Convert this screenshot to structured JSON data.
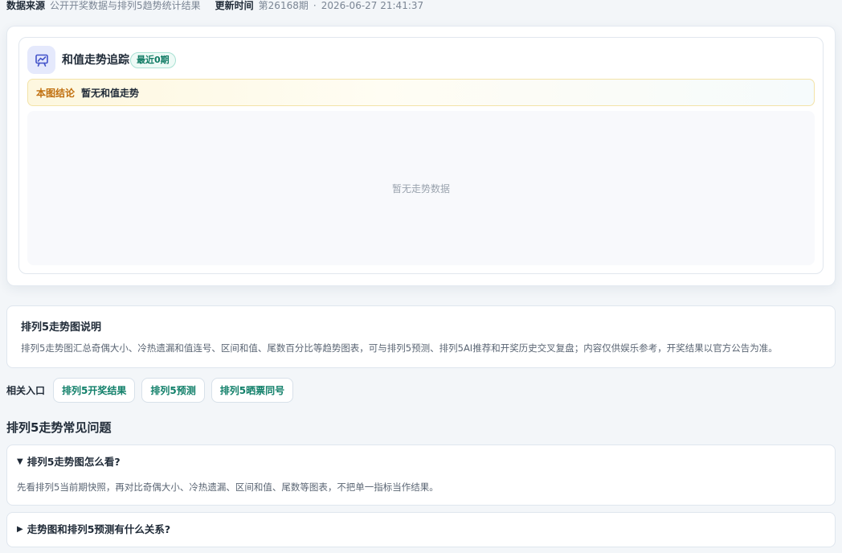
{
  "meta": {
    "source_label": "数据来源",
    "source_value": "公开开奖数据与排列5趋势统计结果",
    "update_label": "更新时间",
    "issue": "第26168期",
    "dot": "·",
    "timestamp": "2026-06-27 21:41:37"
  },
  "chart_card": {
    "icon": "trend-chart-icon",
    "title": "和值走势追踪",
    "badge": "最近0期",
    "conclusion_label": "本图结论",
    "conclusion_text": "暂无和值走势",
    "empty_text": "暂无走势数据"
  },
  "explain": {
    "title": "排列5走势图说明",
    "body": "排列5走势图汇总奇偶大小、冷热遗漏和值连号、区间和值、尾数百分比等趋势图表，可与排列5预测、排列5AI推荐和开奖历史交叉复盘；内容仅供娱乐参考，开奖结果以官方公告为准。"
  },
  "related": {
    "label": "相关入口",
    "links": [
      "排列5开奖结果",
      "排列5预测",
      "排列5晒票同号"
    ]
  },
  "faq": {
    "title": "排列5走势常见问题",
    "items": [
      {
        "arrow": "▼",
        "question": "排列5走势图怎么看?",
        "answer": "先看排列5当前期快照，再对比奇偶大小、冷热遗漏、区间和值、尾数等图表，不把单一指标当作结果。"
      },
      {
        "arrow": "▶",
        "question": "走势图和排列5预测有什么关系?"
      }
    ]
  },
  "colors": {
    "accent_green": "#12806a",
    "conclusion_orange": "#c06f0e",
    "icon_bg": "#e5e9fc",
    "page_bg": "#f3f6f9"
  }
}
